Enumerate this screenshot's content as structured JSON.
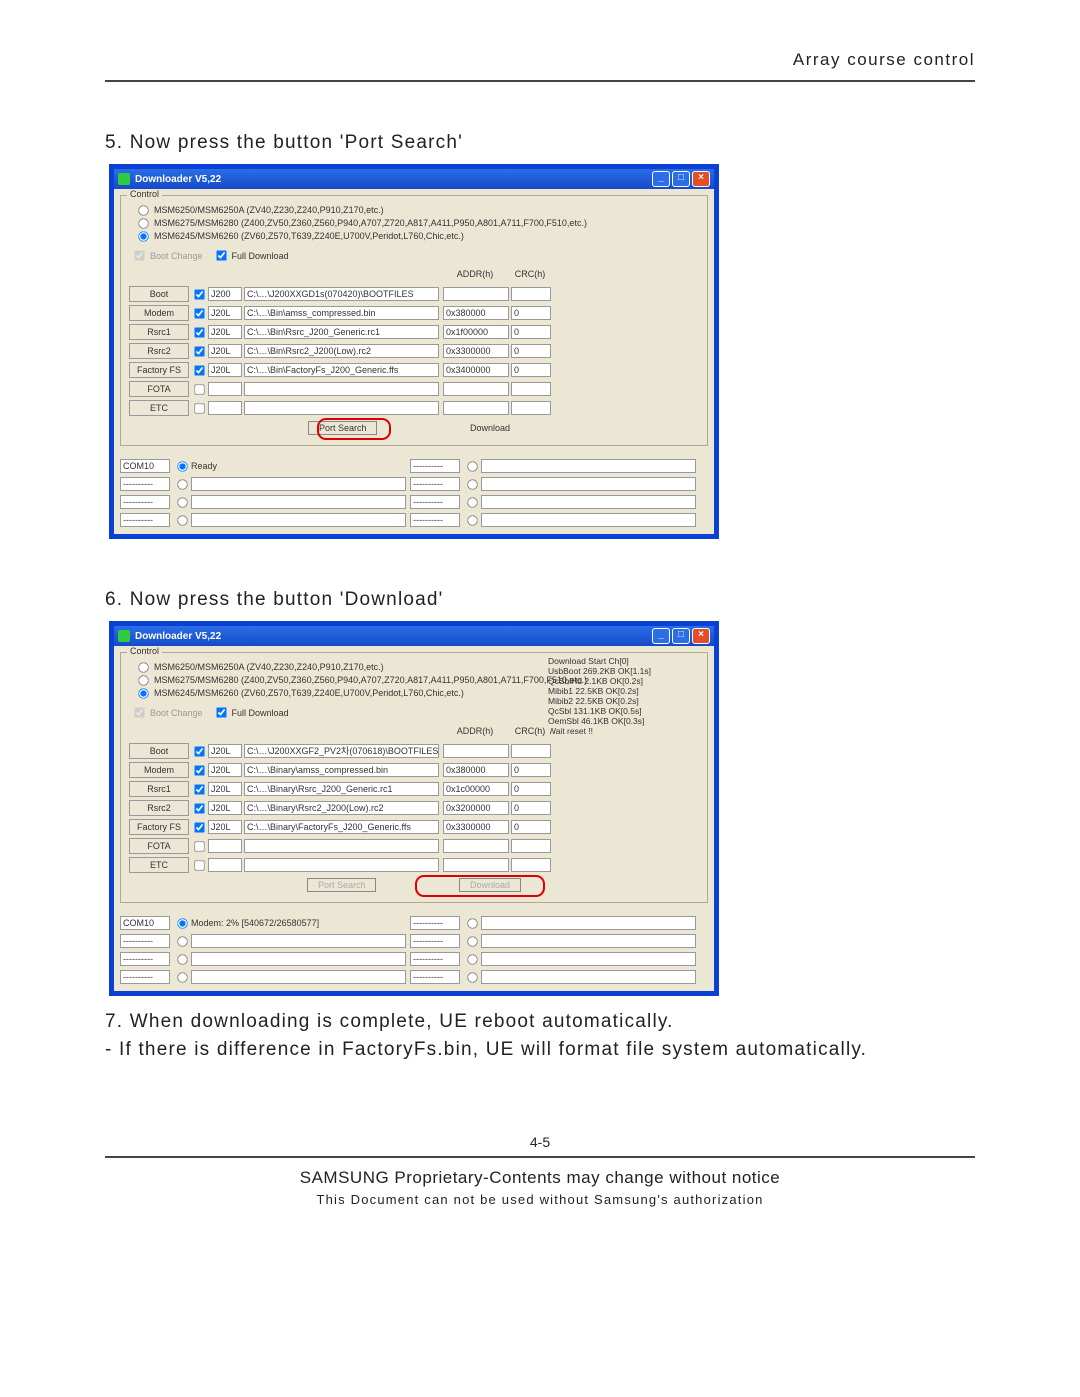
{
  "header_right": "Array  course  control",
  "steps": {
    "s5": "5. Now  press  the  button  'Port  Search'",
    "s6": "6. Now  press  the  button  'Download'",
    "s7": "7.  When  downloading  is  complete,  UE  reboot  automatically.",
    "s7b": "-  If  there  is  difference  in  FactoryFs.bin,  UE  will  format  file  system automatically."
  },
  "footer": {
    "page": "4-5",
    "line1": "SAMSUNG Proprietary-Contents may change without notice",
    "line2": "This  Document  can  not  be  used  without  Samsung's  authorization"
  },
  "app": {
    "title": "Downloader V5,22",
    "controlLegend": "Control",
    "radios": [
      "MSM6250/MSM6250A (ZV40,Z230,Z240,P910,Z170,etc.)",
      "MSM6275/MSM6280 (Z400,ZV50,Z360,Z560,P940,A707,Z720,A817,A411,P950,A801,A711,F700,F510,etc.)",
      "MSM6245/MSM6260 (ZV60,Z570,T639,Z240E,U700V,Peridot,L760,Chic,etc.)"
    ],
    "bootChange": "Boot Change",
    "fullDownload": "Full Download",
    "hdrAddr": "ADDR(h)",
    "hdrCrc": "CRC(h)",
    "portSearch": "Port Search",
    "download": "Download",
    "rows1": [
      {
        "lbl": "Boot",
        "sel": "J200",
        "path": "C:\\…\\J200XXGD1s(070420)\\BOOTFILES",
        "addr": "",
        "crc": ""
      },
      {
        "lbl": "Modem",
        "sel": "J20L",
        "path": "C:\\…\\Bin\\amss_compressed.bin",
        "addr": "0x380000",
        "crc": "0"
      },
      {
        "lbl": "Rsrc1",
        "sel": "J20L",
        "path": "C:\\…\\Bin\\Rsrc_J200_Generic.rc1",
        "addr": "0x1f00000",
        "crc": "0"
      },
      {
        "lbl": "Rsrc2",
        "sel": "J20L",
        "path": "C:\\…\\Bin\\Rsrc2_J200(Low).rc2",
        "addr": "0x3300000",
        "crc": "0"
      },
      {
        "lbl": "Factory FS",
        "sel": "J20L",
        "path": "C:\\…\\Bin\\FactoryFs_J200_Generic.ffs",
        "addr": "0x3400000",
        "crc": "0"
      },
      {
        "lbl": "FOTA",
        "sel": "",
        "path": "",
        "addr": "",
        "crc": ""
      },
      {
        "lbl": "ETC",
        "sel": "",
        "path": "",
        "addr": "",
        "crc": ""
      }
    ],
    "rows2": [
      {
        "lbl": "Boot",
        "sel": "J20L",
        "path": "C:\\…\\J200XXGF2_PV2차(070618)\\BOOTFILES",
        "addr": "",
        "crc": ""
      },
      {
        "lbl": "Modem",
        "sel": "J20L",
        "path": "C:\\…\\Binary\\amss_compressed.bin",
        "addr": "0x380000",
        "crc": "0"
      },
      {
        "lbl": "Rsrc1",
        "sel": "J20L",
        "path": "C:\\…\\Binary\\Rsrc_J200_Generic.rc1",
        "addr": "0x1c00000",
        "crc": "0"
      },
      {
        "lbl": "Rsrc2",
        "sel": "J20L",
        "path": "C:\\…\\Binary\\Rsrc2_J200(Low).rc2",
        "addr": "0x3200000",
        "crc": "0"
      },
      {
        "lbl": "Factory FS",
        "sel": "J20L",
        "path": "C:\\…\\Binary\\FactoryFs_J200_Generic.ffs",
        "addr": "0x3300000",
        "crc": "0"
      },
      {
        "lbl": "FOTA",
        "sel": "",
        "path": "",
        "addr": "",
        "crc": ""
      },
      {
        "lbl": "ETC",
        "sel": "",
        "path": "",
        "addr": "",
        "crc": ""
      }
    ],
    "com1": {
      "port": "COM10",
      "status": "Ready"
    },
    "com2": {
      "port": "COM10",
      "status": "Modem:  2% [540672/26580577]"
    },
    "dash": "----------",
    "log2": [
      "Download Start Ch[0]",
      "UsbBoot 269.2KB OK[1.1s]",
      "QcSblHd 2.1KB OK[0.2s]",
      "Mibib1 22.5KB OK[0.2s]",
      "Mibib2 22.5KB OK[0.2s]",
      "QcSbl 131.1KB OK[0.5s]",
      "OemSbl 46.1KB OK[0.3s]",
      "Wait reset !!"
    ]
  }
}
